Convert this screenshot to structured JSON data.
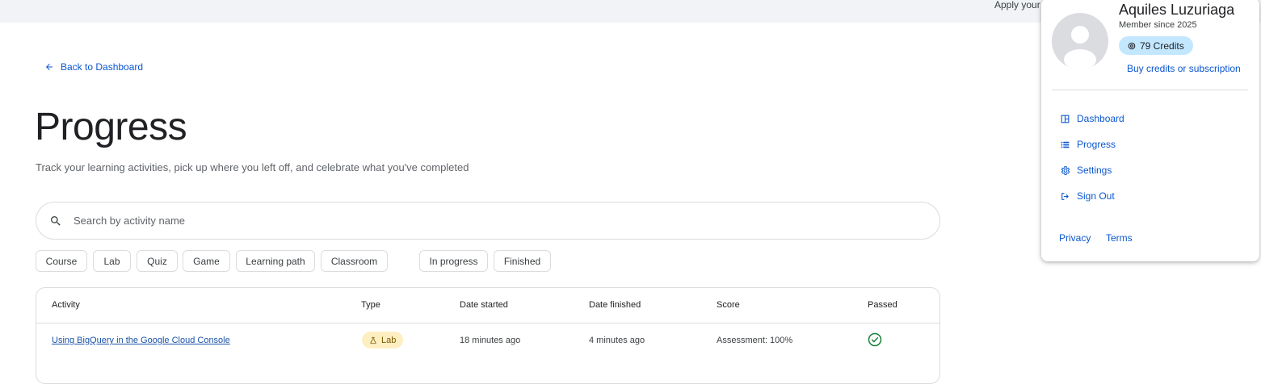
{
  "topbar": {
    "text": "Apply your s"
  },
  "back_link": {
    "label": "Back to Dashboard",
    "icon": "arrow-left-icon"
  },
  "header": {
    "title": "Progress",
    "subtitle": "Track your learning activities, pick up where you left off, and celebrate what you've completed"
  },
  "search": {
    "placeholder": "Search by activity name",
    "value": "",
    "icon": "search-icon"
  },
  "filters": {
    "type_chips": [
      "Course",
      "Lab",
      "Quiz",
      "Game",
      "Learning path",
      "Classroom"
    ],
    "status_chips": [
      "In progress",
      "Finished"
    ]
  },
  "table": {
    "headers": {
      "activity": "Activity",
      "type": "Type",
      "date_started": "Date started",
      "date_finished": "Date finished",
      "score": "Score",
      "passed": "Passed"
    },
    "rows": [
      {
        "activity": "Using BigQuery in the Google Cloud Console",
        "type": "Lab",
        "type_icon": "flask-icon",
        "date_started": "18 minutes ago",
        "date_finished": "4 minutes ago",
        "score": "Assessment: 100%",
        "passed_icon": "check-circle-icon"
      }
    ]
  },
  "user_menu": {
    "name": "Aquiles Luzuriaga",
    "member_since": "Member since 2025",
    "credits": "79 Credits",
    "buy_link": "Buy credits or subscription",
    "items": [
      {
        "label": "Dashboard",
        "icon": "dashboard-icon"
      },
      {
        "label": "Progress",
        "icon": "list-icon"
      },
      {
        "label": "Settings",
        "icon": "gear-icon"
      },
      {
        "label": "Sign Out",
        "icon": "sign-out-icon"
      }
    ],
    "footer": {
      "privacy": "Privacy",
      "terms": "Terms"
    }
  },
  "colors": {
    "link": "#0b57d0",
    "credits_badge": "#c2e7ff",
    "lab_badge": "#feefc3",
    "passed": "#188038",
    "topbar": "#f1f3f6"
  }
}
